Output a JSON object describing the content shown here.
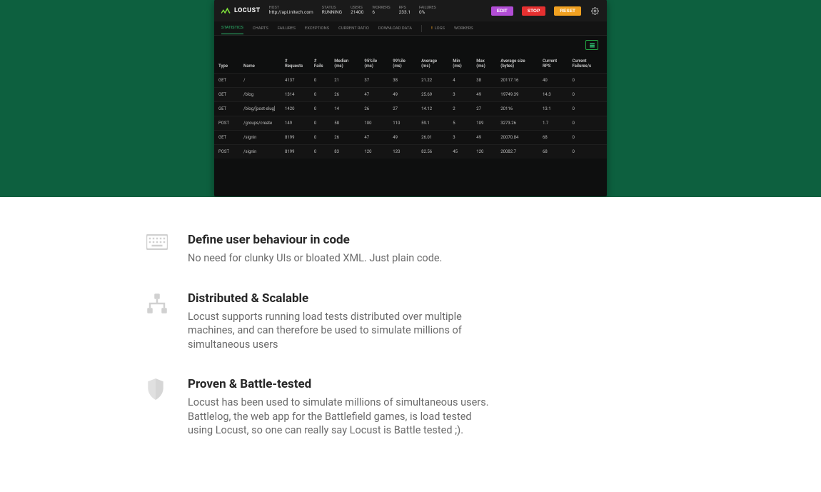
{
  "app": {
    "brand": "LOCUST",
    "header_stats": {
      "host": {
        "label": "HOST",
        "value": "http://api.initech.com"
      },
      "status": {
        "label": "STATUS",
        "value": "RUNNING"
      },
      "users": {
        "label": "USERS",
        "value": "21400"
      },
      "workers": {
        "label": "WORKERS",
        "value": "6"
      },
      "rps": {
        "label": "RPS",
        "value": "233.1"
      },
      "failures": {
        "label": "FAILURES",
        "value": "0%"
      }
    },
    "buttons": {
      "edit": "Edit",
      "stop": "Stop",
      "reset": "Reset"
    },
    "tabs": {
      "statistics": "Statistics",
      "charts": "Charts",
      "failures": "Failures",
      "exceptions": "Exceptions",
      "ratio": "Current Ratio",
      "download": "Download Data",
      "logs": "Logs",
      "workers": "Workers"
    },
    "columns": {
      "type": "Type",
      "name": "Name",
      "requests": "# Requests",
      "fails": "# Fails",
      "median": "Median (ms)",
      "p95": "95%ile (ms)",
      "p99": "99%ile (ms)",
      "avg": "Average (ms)",
      "min": "Min (ms)",
      "max": "Max (ms)",
      "size": "Average size (bytes)",
      "cur_rps": "Current RPS",
      "cur_fails": "Current Failures/s"
    },
    "rows": [
      {
        "type": "GET",
        "name": "/",
        "requests": "4137",
        "fails": "0",
        "median": "21",
        "p95": "37",
        "p99": "38",
        "avg": "21.22",
        "min": "4",
        "max": "38",
        "size": "20117.16",
        "cur_rps": "40",
        "cur_fails": "0"
      },
      {
        "type": "GET",
        "name": "/blog",
        "requests": "1314",
        "fails": "0",
        "median": "26",
        "p95": "47",
        "p99": "49",
        "avg": "25.69",
        "min": "3",
        "max": "49",
        "size": "19749.39",
        "cur_rps": "14.3",
        "cur_fails": "0"
      },
      {
        "type": "GET",
        "name": "/blog/[post-slug]",
        "requests": "1420",
        "fails": "0",
        "median": "14",
        "p95": "26",
        "p99": "27",
        "avg": "14.12",
        "min": "2",
        "max": "27",
        "size": "20116",
        "cur_rps": "13.1",
        "cur_fails": "0"
      },
      {
        "type": "POST",
        "name": "/groups/create",
        "requests": "149",
        "fails": "0",
        "median": "58",
        "p95": "100",
        "p99": "110",
        "avg": "59.1",
        "min": "5",
        "max": "109",
        "size": "3273.26",
        "cur_rps": "1.7",
        "cur_fails": "0"
      },
      {
        "type": "GET",
        "name": "/signin",
        "requests": "8199",
        "fails": "0",
        "median": "26",
        "p95": "47",
        "p99": "49",
        "avg": "26.01",
        "min": "3",
        "max": "49",
        "size": "20070.84",
        "cur_rps": "68",
        "cur_fails": "0"
      },
      {
        "type": "POST",
        "name": "/signin",
        "requests": "8199",
        "fails": "0",
        "median": "83",
        "p95": "120",
        "p99": "120",
        "avg": "82.56",
        "min": "45",
        "max": "120",
        "size": "20082.7",
        "cur_rps": "68",
        "cur_fails": "0"
      }
    ]
  },
  "features": {
    "code": {
      "title": "Define user behaviour in code",
      "body": "No need for clunky UIs or bloated XML. Just plain code."
    },
    "dist": {
      "title": "Distributed & Scalable",
      "body": "Locust supports running load tests distributed over multiple machines, and can therefore be used to simulate millions of simultaneous users"
    },
    "proven": {
      "title": "Proven & Battle-tested",
      "body": "Locust has been used to simulate millions of simultaneous users. Battlelog, the web app for the Battlefield games, is load tested using Locust, so one can really say Locust is Battle tested ;)."
    }
  }
}
